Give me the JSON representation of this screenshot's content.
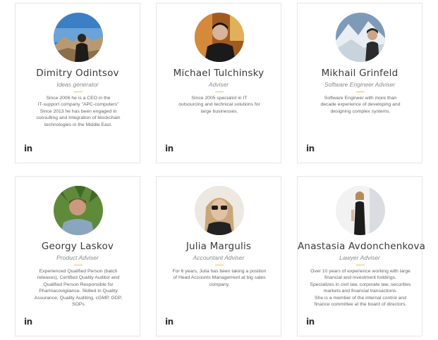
{
  "team": [
    {
      "name": "Dimitry Odintsov",
      "role": "Ideas generator",
      "bio": "Since 2006 he is a CEO in the\nIT-support company \"APC-computers\"\nSince 2013 he has been engaged in\nconsulting and integration of blockchain\ntechnologies in the Middle East.",
      "linkedin": "in"
    },
    {
      "name": "Michael Tulchinsky",
      "role": "Adviser",
      "bio": "Since 2005 specialist in IT\noutsourcing and technical solutions for\nlarge businesses.",
      "linkedin": "in"
    },
    {
      "name": "Mikhail Grinfeld",
      "role": "Software Engineer Adviser",
      "bio": "Software Engineer with more than\ndecade experience of developing and\ndesigning complex systems.",
      "linkedin": "in"
    },
    {
      "name": "Georgy Laskov",
      "role": "Product Adviser",
      "bio": "Experienced Qualified Person (batch\nreleases), Certified Quality Auditor and\nQualified Person Responsible for\nPharmacovigilance. Skilled in Quality\nAssurance, Quality Auditing, cGMP, GDP,\nSOPs",
      "linkedin": "in"
    },
    {
      "name": "Julia Margulis",
      "role": "Accountant Adviser",
      "bio": "For 6 years, Julia has been taking a position\nof Head Accounts Management at big sales\ncompany.",
      "linkedin": "in"
    },
    {
      "name": "Anastasia Avdonchenkova",
      "role": "Lawyer Adviser",
      "bio": "Over 10 years of experience working with large\nfinancial and investment holdings.\nSpecializes in civil law, corporate law, securities\nmarkets and financial transactions.\nShe is a member of the internal control and\nfinance committee at the board of directors.",
      "linkedin": "in"
    }
  ]
}
